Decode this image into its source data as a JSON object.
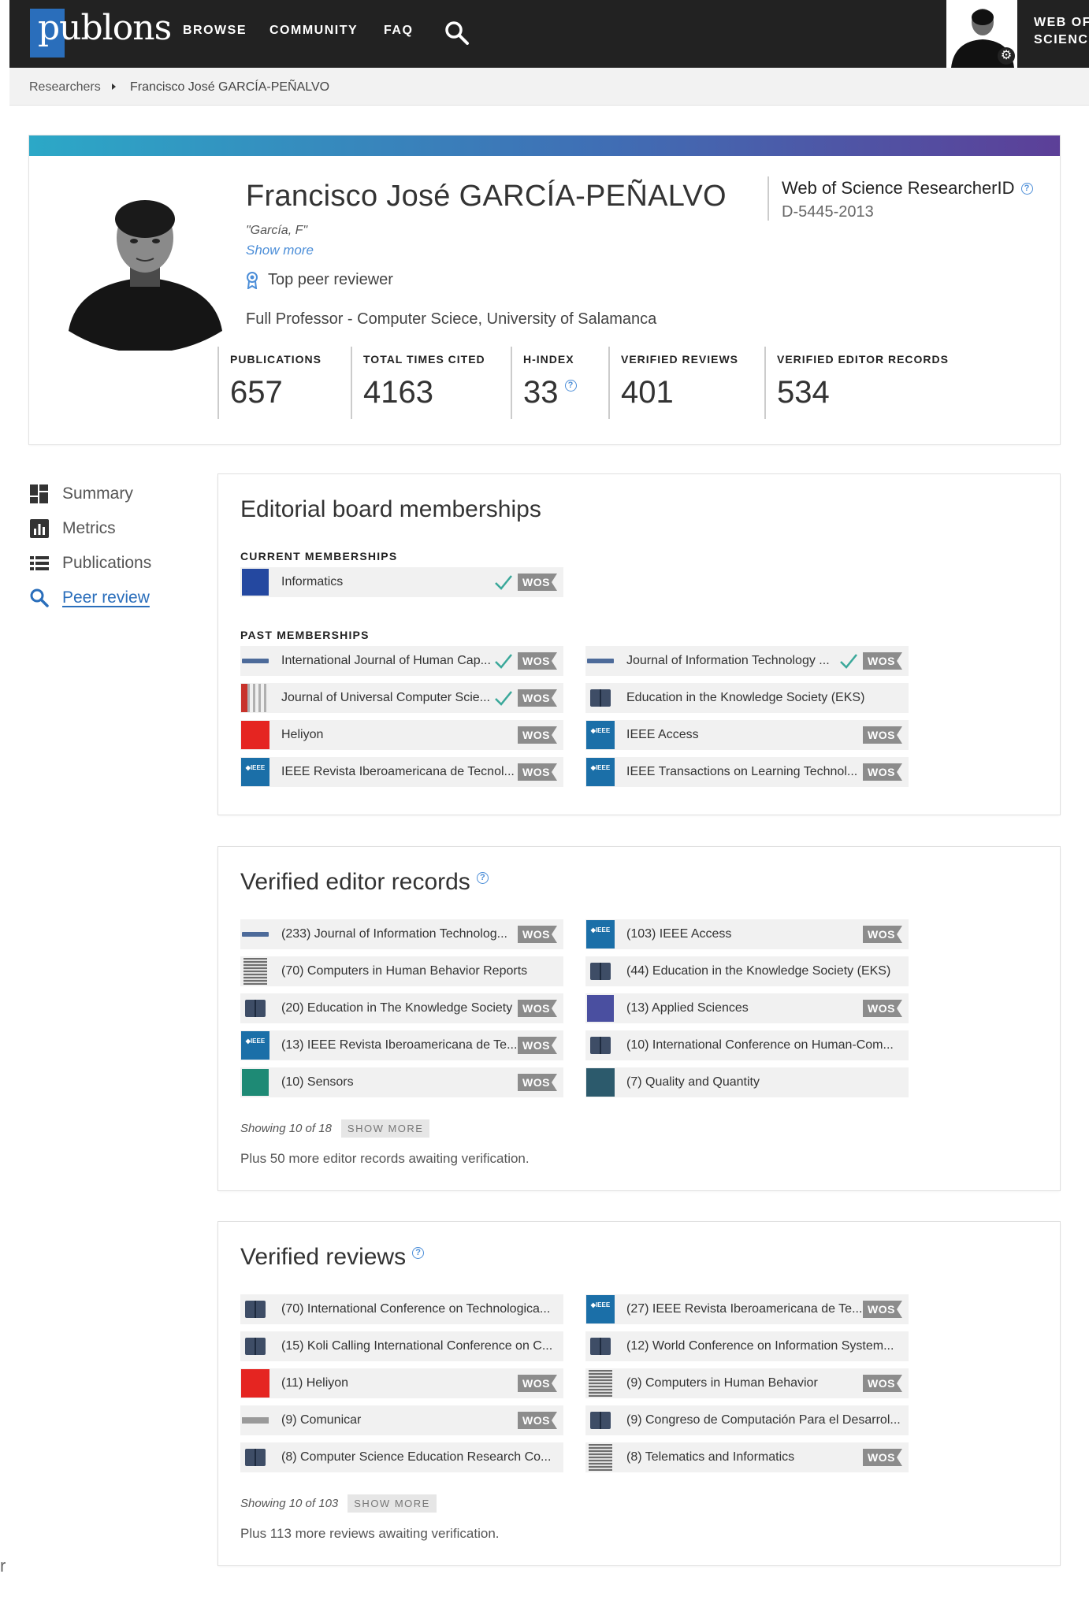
{
  "nav": {
    "logo": "publons",
    "items": [
      "BROWSE",
      "COMMUNITY",
      "FAQ"
    ],
    "wos_line1": "WEB OF",
    "wos_line2": "SCIENCE"
  },
  "breadcrumb": {
    "root": "Researchers",
    "current": "Francisco José GARCÍA-PEÑALVO"
  },
  "profile": {
    "name": "Francisco José GARCÍA-PEÑALVO",
    "alias": "\"García, F\"",
    "show_more": "Show more",
    "badge": "Top peer reviewer",
    "affiliation": "Full Professor - Computer Sciece, University of Salamanca",
    "researcher_id_label": "Web of Science ResearcherID",
    "researcher_id": "D-5445-2013",
    "metrics": [
      {
        "label": "PUBLICATIONS",
        "value": "657"
      },
      {
        "label": "TOTAL TIMES CITED",
        "value": "4163"
      },
      {
        "label": "H-INDEX",
        "value": "33"
      },
      {
        "label": "VERIFIED REVIEWS",
        "value": "401"
      },
      {
        "label": "VERIFIED EDITOR RECORDS",
        "value": "534"
      }
    ]
  },
  "sidenav": [
    "Summary",
    "Metrics",
    "Publications",
    "Peer review"
  ],
  "editorial": {
    "title": "Editorial board memberships",
    "current_label": "CURRENT MEMBERSHIPS",
    "past_label": "PAST MEMBERSHIPS",
    "wos": "WOS",
    "current": [
      {
        "text": "Informatics",
        "check": true,
        "wos": true,
        "thumb": "info"
      }
    ],
    "past": [
      {
        "text": "International Journal of Human Cap...",
        "check": true,
        "wos": true,
        "thumb": "bar"
      },
      {
        "text": "Journal of Information Technology ...",
        "check": true,
        "wos": true,
        "thumb": "bar"
      },
      {
        "text": "Journal of Universal Computer Scie...",
        "check": true,
        "wos": true,
        "thumb": "jucs"
      },
      {
        "text": "Education in the Knowledge Society (EKS)",
        "check": false,
        "wos": false,
        "thumb": "book"
      },
      {
        "text": "Heliyon",
        "check": false,
        "wos": true,
        "thumb": "red"
      },
      {
        "text": "IEEE Access",
        "check": false,
        "wos": true,
        "thumb": "ieee"
      },
      {
        "text": "IEEE Revista Iberoamericana de Tecnol...",
        "check": false,
        "wos": true,
        "thumb": "ieee"
      },
      {
        "text": "IEEE Transactions on Learning Technol...",
        "check": false,
        "wos": true,
        "thumb": "ieee"
      }
    ]
  },
  "editor_records": {
    "title": "Verified editor records",
    "items": [
      {
        "text": "(233) Journal of Information Technolog...",
        "wos": true,
        "thumb": "bar"
      },
      {
        "text": "(103) IEEE Access",
        "wos": true,
        "thumb": "ieee"
      },
      {
        "text": "(70) Computers in Human Behavior Reports",
        "wos": false,
        "thumb": "elsevier"
      },
      {
        "text": "(44) Education in the Knowledge Society (EKS)",
        "wos": false,
        "thumb": "book"
      },
      {
        "text": "(20) Education in The Knowledge Society",
        "wos": true,
        "thumb": "book"
      },
      {
        "text": "(13) Applied Sciences",
        "wos": true,
        "thumb": "grid"
      },
      {
        "text": "(13) IEEE Revista Iberoamericana de Te...",
        "wos": true,
        "thumb": "ieee"
      },
      {
        "text": "(10) International Conference on Human-Com...",
        "wos": false,
        "thumb": "book"
      },
      {
        "text": "(10) Sensors",
        "wos": true,
        "thumb": "teal"
      },
      {
        "text": "(7) Quality and Quantity",
        "wos": false,
        "thumb": "qq"
      }
    ],
    "showing": "Showing 10 of 18",
    "show_more": "SHOW MORE",
    "awaiting": "Plus 50 more editor records awaiting verification."
  },
  "reviews": {
    "title": "Verified reviews",
    "items": [
      {
        "text": "(70) International Conference on Technologica...",
        "wos": false,
        "thumb": "book"
      },
      {
        "text": "(27) IEEE Revista Iberoamericana de Te...",
        "wos": true,
        "thumb": "ieee"
      },
      {
        "text": "(15) Koli Calling International Conference on C...",
        "wos": false,
        "thumb": "book"
      },
      {
        "text": "(12) World Conference on Information System...",
        "wos": false,
        "thumb": "book"
      },
      {
        "text": "(11) Heliyon",
        "wos": true,
        "thumb": "red"
      },
      {
        "text": "(9) Computers in Human Behavior",
        "wos": true,
        "thumb": "elsevier"
      },
      {
        "text": "(9) Comunicar",
        "wos": true,
        "thumb": "comu"
      },
      {
        "text": "(9) Congreso de Computación Para el Desarrol...",
        "wos": false,
        "thumb": "book"
      },
      {
        "text": "(8) Computer Science Education Research Co...",
        "wos": false,
        "thumb": "book"
      },
      {
        "text": "(8) Telematics and Informatics",
        "wos": true,
        "thumb": "elsevier"
      }
    ],
    "showing": "Showing 10 of 103",
    "show_more": "SHOW MORE",
    "awaiting": "Plus 113 more reviews awaiting verification."
  },
  "gutter_char": "r",
  "colors": {
    "accent": "#2a6ebb",
    "navbar": "#222222",
    "check": "#3aa89a",
    "wos_badge": "#8c8c8c"
  }
}
